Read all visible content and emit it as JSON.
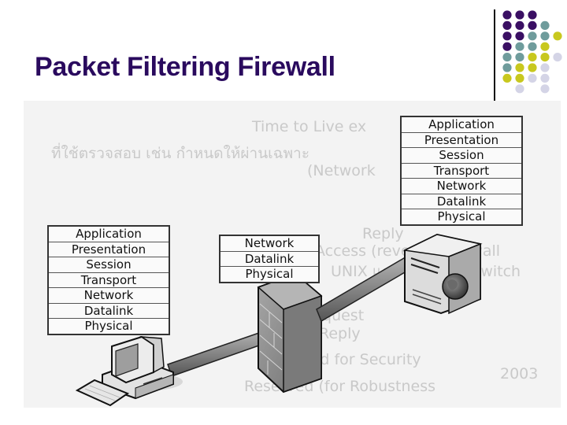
{
  "slide": {
    "title": "Packet Filtering Firewall"
  },
  "decoration": {
    "dot_colors": {
      "purple": "#3a0f63",
      "teal": "#6f9c9c",
      "yellow": "#c8c81e",
      "lavender": "#d4d4e6"
    }
  },
  "diagram": {
    "server_stack": {
      "label": "Server OSI stack",
      "layers": [
        "Application",
        "Presentation",
        "Session",
        "Transport",
        "Network",
        "Datalink",
        "Physical"
      ]
    },
    "client_stack": {
      "label": "Client OSI stack",
      "layers": [
        "Application",
        "Presentation",
        "Session",
        "Transport",
        "Network",
        "Datalink",
        "Physical"
      ]
    },
    "firewall_stack": {
      "label": "Firewall stack",
      "layers": [
        "Network",
        "Datalink",
        "Physical"
      ]
    },
    "nodes": {
      "client": "Client computer",
      "firewall": "Firewall",
      "server": "Server"
    },
    "background_text": [
      "Time to Live ex",
      "ที่ใช้ตรวจสอบ เช่น กำหนดให้ผ่านเฉพาะ",
      "(Network",
      "Reply",
      "Access (reverse) Firewall",
      "UNIX และ Network Switch",
      "Mask Request",
      "Mask Reply",
      "Reserved for Security",
      "2003",
      "Reserved (for Robustness"
    ]
  }
}
